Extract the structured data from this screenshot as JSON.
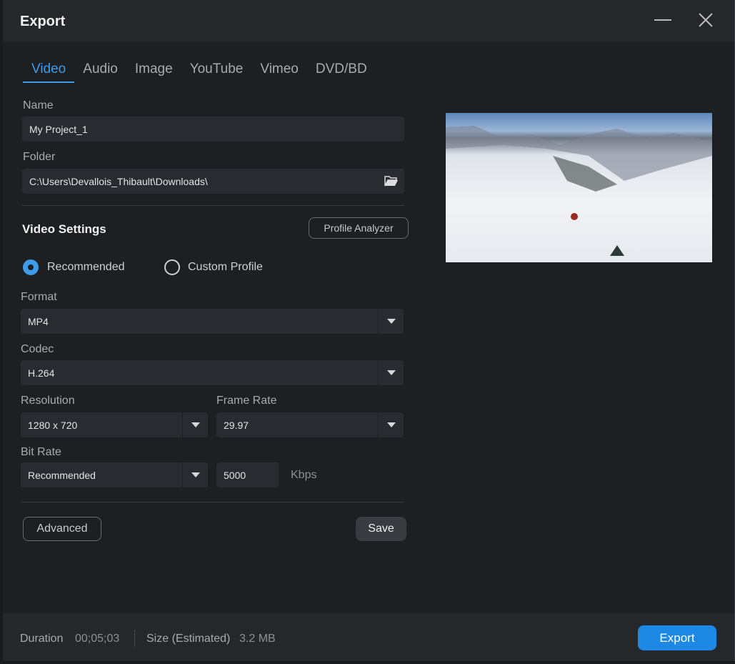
{
  "window": {
    "title": "Export"
  },
  "tabs": [
    {
      "label": "Video"
    },
    {
      "label": "Audio"
    },
    {
      "label": "Image"
    },
    {
      "label": "YouTube"
    },
    {
      "label": "Vimeo"
    },
    {
      "label": "DVD/BD"
    }
  ],
  "name": {
    "label": "Name",
    "value": "My Project_1"
  },
  "folder": {
    "label": "Folder",
    "value": "C:\\Users\\Devallois_Thibault\\Downloads\\"
  },
  "video_settings": {
    "title": "Video Settings",
    "profile_analyzer": "Profile Analyzer",
    "recommended": "Recommended",
    "custom_profile": "Custom Profile",
    "selected": "Recommended"
  },
  "format": {
    "label": "Format",
    "value": "MP4"
  },
  "codec": {
    "label": "Codec",
    "value": "H.264"
  },
  "resolution": {
    "label": "Resolution",
    "value": "1280 x 720"
  },
  "frame_rate": {
    "label": "Frame Rate",
    "value": "29.97"
  },
  "bit_rate": {
    "label": "Bit Rate",
    "mode": "Recommended",
    "value": "5000",
    "unit": "Kbps"
  },
  "buttons": {
    "advanced": "Advanced",
    "save": "Save",
    "export": "Export"
  },
  "footer": {
    "duration_label": "Duration",
    "duration": "00;05;03",
    "size_label": "Size (Estimated)",
    "size": "3.2 MB"
  },
  "colors": {
    "accent": "#1e88e5"
  }
}
